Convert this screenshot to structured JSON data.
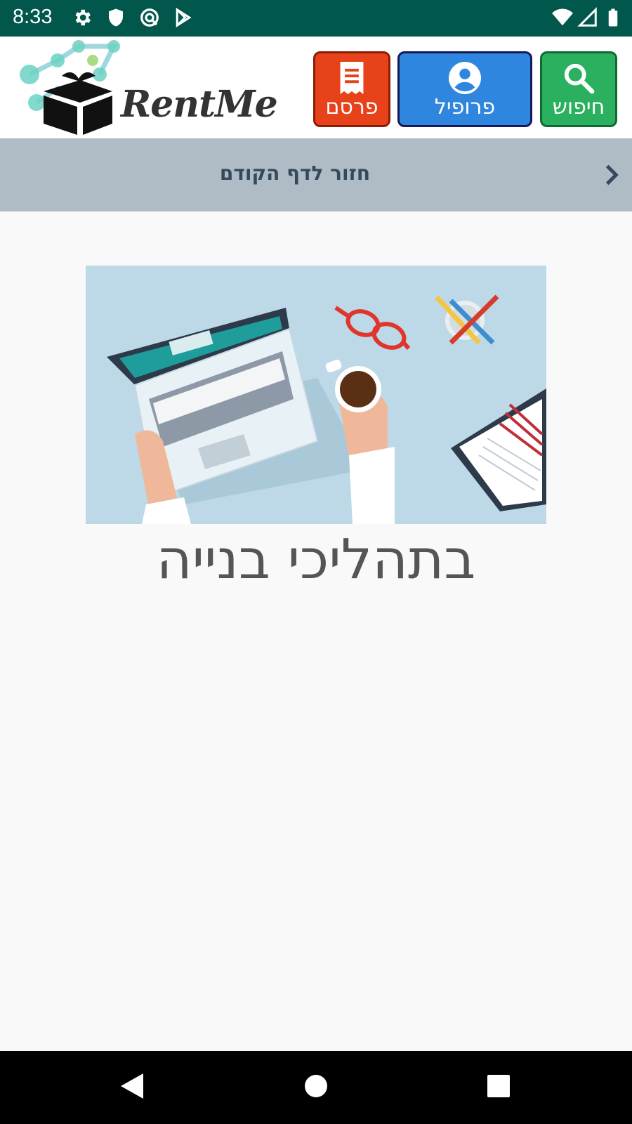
{
  "status_bar": {
    "time": "8:33",
    "icons": [
      "gear-icon",
      "shield-icon",
      "vpn-icon",
      "play-store-icon",
      "wifi-icon",
      "signal-icon",
      "battery-icon"
    ]
  },
  "header": {
    "logo_text": "RentMe",
    "buttons": {
      "publish": "פרסם",
      "profile": "פרופיל",
      "search": "חיפוש"
    }
  },
  "back_bar": {
    "label": "חזור לדף הקודם"
  },
  "main": {
    "message": "בתהליכי בנייה"
  },
  "colors": {
    "status_bar": "#01574b",
    "publish": "#e8421a",
    "profile": "#2e86de",
    "search": "#2bb05f",
    "back_bar": "#b0bcc5"
  }
}
